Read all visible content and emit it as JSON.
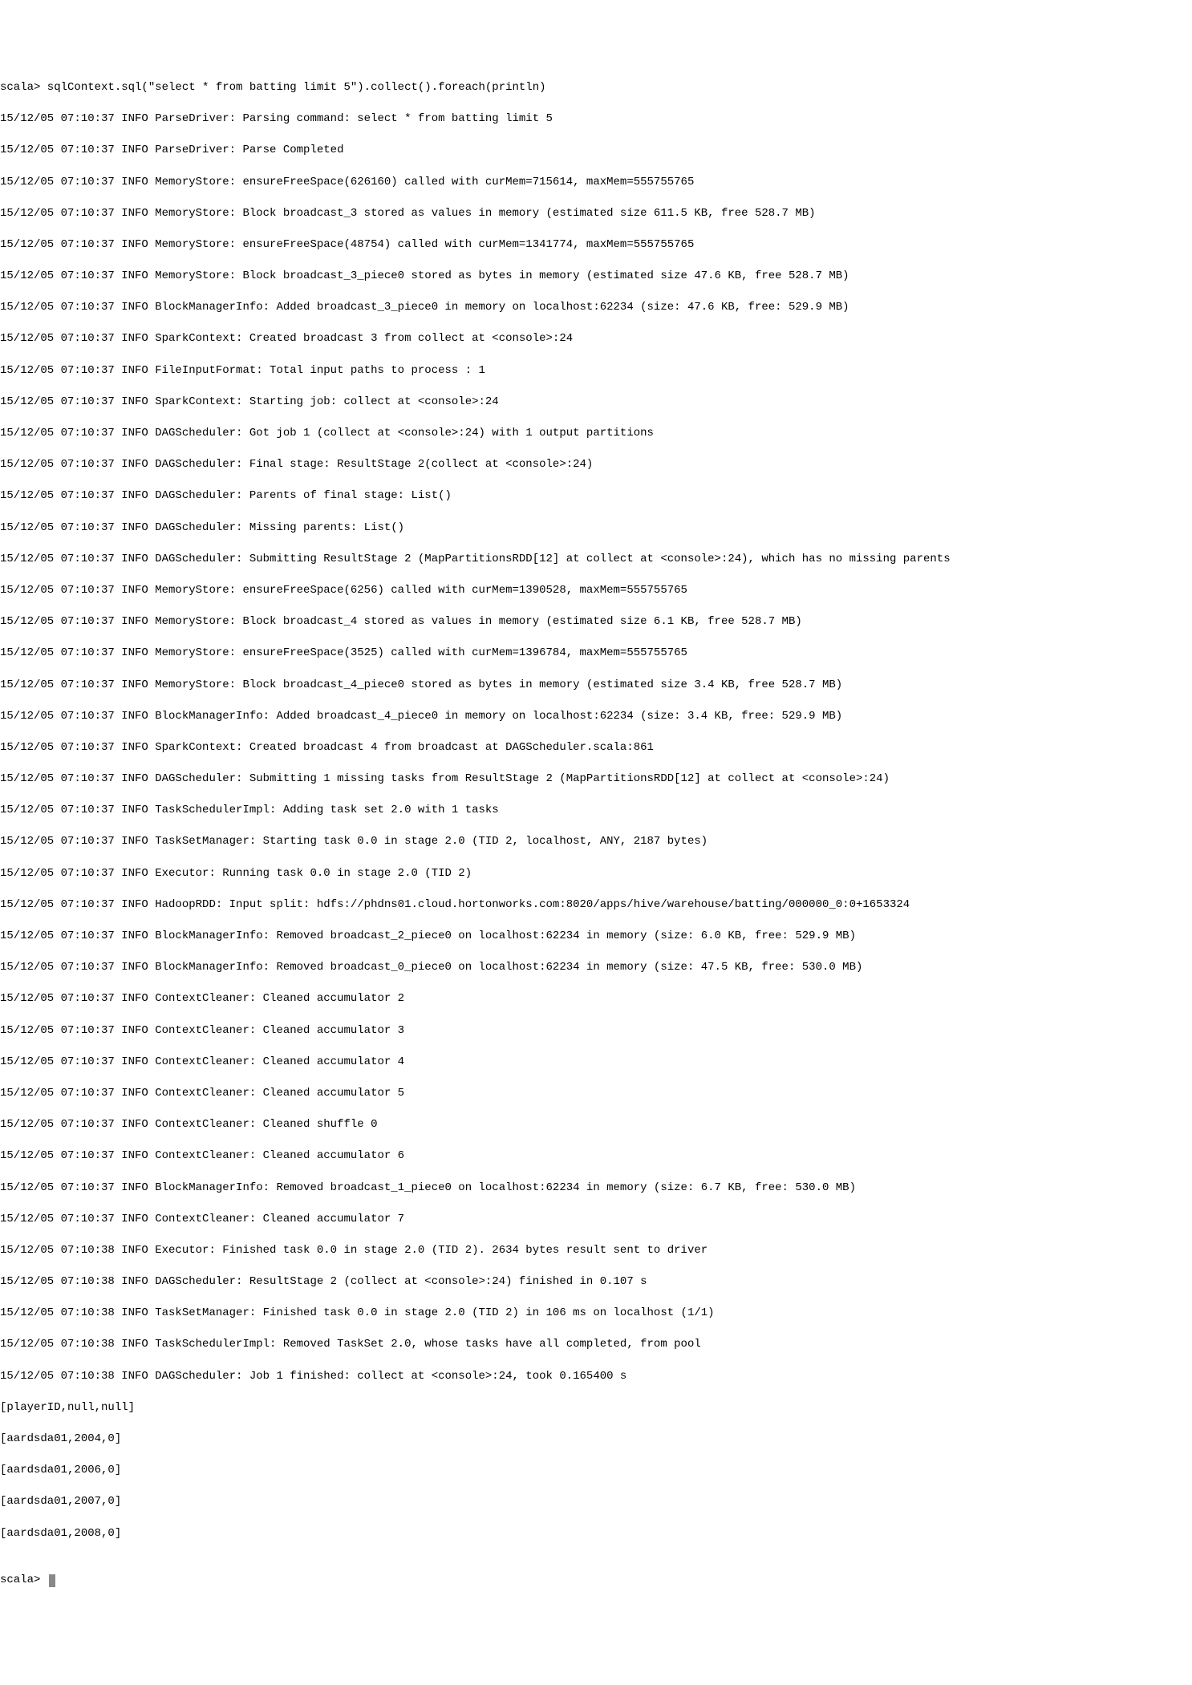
{
  "terminal": {
    "prompt1": "scala> sqlContext.sql(\"select * from batting limit 5\").collect().foreach(println)",
    "lines": [
      "15/12/05 07:10:37 INFO ParseDriver: Parsing command: select * from batting limit 5",
      "15/12/05 07:10:37 INFO ParseDriver: Parse Completed",
      "15/12/05 07:10:37 INFO MemoryStore: ensureFreeSpace(626160) called with curMem=715614, maxMem=555755765",
      "15/12/05 07:10:37 INFO MemoryStore: Block broadcast_3 stored as values in memory (estimated size 611.5 KB, free 528.7 MB)",
      "15/12/05 07:10:37 INFO MemoryStore: ensureFreeSpace(48754) called with curMem=1341774, maxMem=555755765",
      "15/12/05 07:10:37 INFO MemoryStore: Block broadcast_3_piece0 stored as bytes in memory (estimated size 47.6 KB, free 528.7 MB)",
      "15/12/05 07:10:37 INFO BlockManagerInfo: Added broadcast_3_piece0 in memory on localhost:62234 (size: 47.6 KB, free: 529.9 MB)",
      "15/12/05 07:10:37 INFO SparkContext: Created broadcast 3 from collect at <console>:24",
      "15/12/05 07:10:37 INFO FileInputFormat: Total input paths to process : 1",
      "15/12/05 07:10:37 INFO SparkContext: Starting job: collect at <console>:24",
      "15/12/05 07:10:37 INFO DAGScheduler: Got job 1 (collect at <console>:24) with 1 output partitions",
      "15/12/05 07:10:37 INFO DAGScheduler: Final stage: ResultStage 2(collect at <console>:24)",
      "15/12/05 07:10:37 INFO DAGScheduler: Parents of final stage: List()",
      "15/12/05 07:10:37 INFO DAGScheduler: Missing parents: List()",
      "15/12/05 07:10:37 INFO DAGScheduler: Submitting ResultStage 2 (MapPartitionsRDD[12] at collect at <console>:24), which has no missing parents",
      "15/12/05 07:10:37 INFO MemoryStore: ensureFreeSpace(6256) called with curMem=1390528, maxMem=555755765",
      "15/12/05 07:10:37 INFO MemoryStore: Block broadcast_4 stored as values in memory (estimated size 6.1 KB, free 528.7 MB)",
      "15/12/05 07:10:37 INFO MemoryStore: ensureFreeSpace(3525) called with curMem=1396784, maxMem=555755765",
      "15/12/05 07:10:37 INFO MemoryStore: Block broadcast_4_piece0 stored as bytes in memory (estimated size 3.4 KB, free 528.7 MB)",
      "15/12/05 07:10:37 INFO BlockManagerInfo: Added broadcast_4_piece0 in memory on localhost:62234 (size: 3.4 KB, free: 529.9 MB)",
      "15/12/05 07:10:37 INFO SparkContext: Created broadcast 4 from broadcast at DAGScheduler.scala:861",
      "15/12/05 07:10:37 INFO DAGScheduler: Submitting 1 missing tasks from ResultStage 2 (MapPartitionsRDD[12] at collect at <console>:24)",
      "15/12/05 07:10:37 INFO TaskSchedulerImpl: Adding task set 2.0 with 1 tasks",
      "15/12/05 07:10:37 INFO TaskSetManager: Starting task 0.0 in stage 2.0 (TID 2, localhost, ANY, 2187 bytes)",
      "15/12/05 07:10:37 INFO Executor: Running task 0.0 in stage 2.0 (TID 2)",
      "15/12/05 07:10:37 INFO HadoopRDD: Input split: hdfs://phdns01.cloud.hortonworks.com:8020/apps/hive/warehouse/batting/000000_0:0+1653324",
      "15/12/05 07:10:37 INFO BlockManagerInfo: Removed broadcast_2_piece0 on localhost:62234 in memory (size: 6.0 KB, free: 529.9 MB)",
      "15/12/05 07:10:37 INFO BlockManagerInfo: Removed broadcast_0_piece0 on localhost:62234 in memory (size: 47.5 KB, free: 530.0 MB)",
      "15/12/05 07:10:37 INFO ContextCleaner: Cleaned accumulator 2",
      "15/12/05 07:10:37 INFO ContextCleaner: Cleaned accumulator 3",
      "15/12/05 07:10:37 INFO ContextCleaner: Cleaned accumulator 4",
      "15/12/05 07:10:37 INFO ContextCleaner: Cleaned accumulator 5",
      "15/12/05 07:10:37 INFO ContextCleaner: Cleaned shuffle 0",
      "15/12/05 07:10:37 INFO ContextCleaner: Cleaned accumulator 6",
      "15/12/05 07:10:37 INFO BlockManagerInfo: Removed broadcast_1_piece0 on localhost:62234 in memory (size: 6.7 KB, free: 530.0 MB)",
      "15/12/05 07:10:37 INFO ContextCleaner: Cleaned accumulator 7",
      "15/12/05 07:10:38 INFO Executor: Finished task 0.0 in stage 2.0 (TID 2). 2634 bytes result sent to driver",
      "15/12/05 07:10:38 INFO DAGScheduler: ResultStage 2 (collect at <console>:24) finished in 0.107 s",
      "15/12/05 07:10:38 INFO TaskSetManager: Finished task 0.0 in stage 2.0 (TID 2) in 106 ms on localhost (1/1)",
      "15/12/05 07:10:38 INFO TaskSchedulerImpl: Removed TaskSet 2.0, whose tasks have all completed, from pool",
      "15/12/05 07:10:38 INFO DAGScheduler: Job 1 finished: collect at <console>:24, took 0.165400 s",
      "[playerID,null,null]",
      "[aardsda01,2004,0]",
      "[aardsda01,2006,0]",
      "[aardsda01,2007,0]",
      "[aardsda01,2008,0]"
    ],
    "blank": "",
    "prompt2": "scala> "
  }
}
